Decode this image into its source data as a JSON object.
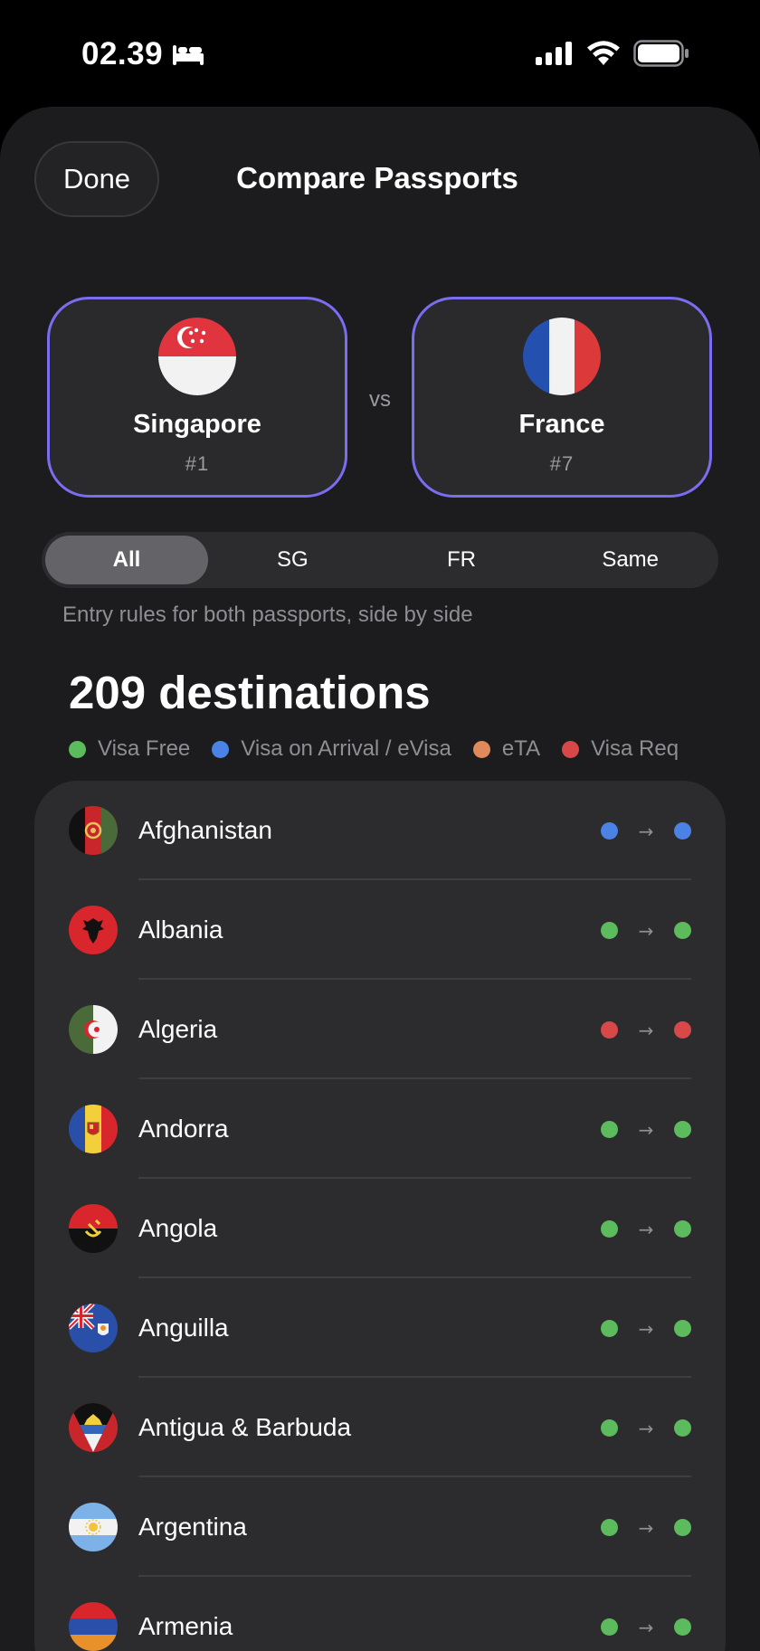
{
  "status_bar": {
    "time": "02.39"
  },
  "colors": {
    "visa_free": "#5cbb5c",
    "visa_on_arrival": "#4a82e6",
    "eta": "#e0895a",
    "visa_required": "#d94848",
    "accent": "#7b6df0"
  },
  "header": {
    "done_label": "Done",
    "title": "Compare Passports"
  },
  "passports": [
    {
      "name": "Singapore",
      "rank": "#1",
      "flag_icon": "singapore-flag-icon"
    },
    {
      "name": "France",
      "rank": "#7",
      "flag_icon": "france-flag-icon"
    }
  ],
  "vs_label": "vs",
  "segments": [
    {
      "label": "All",
      "active": true
    },
    {
      "label": "SG",
      "active": false
    },
    {
      "label": "FR",
      "active": false
    },
    {
      "label": "Same",
      "active": false
    }
  ],
  "segment_hint": "Entry rules for both passports, side by side",
  "destinations_count": "209 destinations",
  "legend": [
    {
      "label": "Visa Free",
      "status": "visa_free"
    },
    {
      "label": "Visa on Arrival / eVisa",
      "status": "visa_on_arrival"
    },
    {
      "label": "eTA",
      "status": "eta"
    },
    {
      "label": "Visa Req",
      "status": "visa_required"
    }
  ],
  "destinations": [
    {
      "name": "Afghanistan",
      "from": "visa_on_arrival",
      "to": "visa_on_arrival"
    },
    {
      "name": "Albania",
      "from": "visa_free",
      "to": "visa_free"
    },
    {
      "name": "Algeria",
      "from": "visa_required",
      "to": "visa_required"
    },
    {
      "name": "Andorra",
      "from": "visa_free",
      "to": "visa_free"
    },
    {
      "name": "Angola",
      "from": "visa_free",
      "to": "visa_free"
    },
    {
      "name": "Anguilla",
      "from": "visa_free",
      "to": "visa_free"
    },
    {
      "name": "Antigua & Barbuda",
      "from": "visa_free",
      "to": "visa_free"
    },
    {
      "name": "Argentina",
      "from": "visa_free",
      "to": "visa_free"
    },
    {
      "name": "Armenia",
      "from": "visa_free",
      "to": "visa_free"
    }
  ]
}
